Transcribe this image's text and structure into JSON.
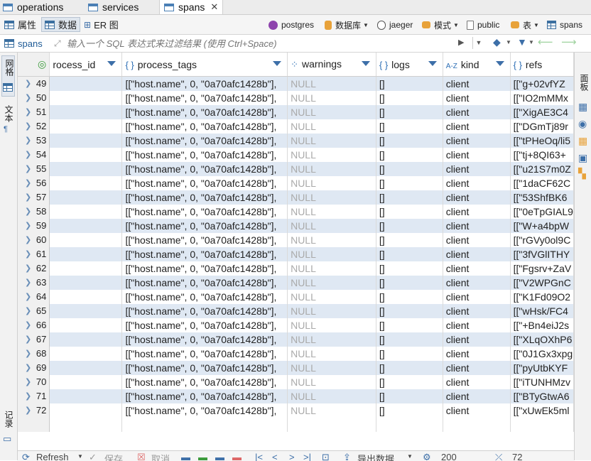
{
  "editor_tabs": [
    {
      "label": "operations"
    },
    {
      "label": "services"
    },
    {
      "label": "spans"
    }
  ],
  "view_tabs": {
    "properties": "属性",
    "data": "数据",
    "er": "ER 图"
  },
  "breadcrumb": {
    "connection": "postgres",
    "database_label": "数据库",
    "database": "jaeger",
    "schema_label": "模式",
    "schema": "public",
    "table_label": "表",
    "table": "spans"
  },
  "filter": {
    "table": "spans",
    "placeholder": "输入一个 SQL 表达式来过滤结果 (使用 Ctrl+Space)"
  },
  "left_rail": {
    "grid": "网格",
    "text": "文本",
    "record": "记录"
  },
  "right_rail": {
    "panels": "面板"
  },
  "columns": [
    {
      "type": "",
      "name": "rocess_id"
    },
    {
      "type": "{ }",
      "name": "process_tags"
    },
    {
      "type": "⁘",
      "name": "warnings"
    },
    {
      "type": "{ }",
      "name": "logs"
    },
    {
      "type": "A-Z",
      "name": "kind"
    },
    {
      "type": "{ }",
      "name": "refs"
    }
  ],
  "rows": [
    {
      "n": "49",
      "tags": "[[\"host.name\", 0, \"0a70afc1428b\"],",
      "warnings": "NULL",
      "logs": "[]",
      "kind": "client",
      "refs": "[[\"g+02vfYZ"
    },
    {
      "n": "50",
      "tags": "[[\"host.name\", 0, \"0a70afc1428b\"],",
      "warnings": "NULL",
      "logs": "[]",
      "kind": "client",
      "refs": "[[\"IO2mMMx"
    },
    {
      "n": "51",
      "tags": "[[\"host.name\", 0, \"0a70afc1428b\"],",
      "warnings": "NULL",
      "logs": "[]",
      "kind": "client",
      "refs": "[[\"XigAE3C4"
    },
    {
      "n": "52",
      "tags": "[[\"host.name\", 0, \"0a70afc1428b\"],",
      "warnings": "NULL",
      "logs": "[]",
      "kind": "client",
      "refs": "[[\"DGmTj89r"
    },
    {
      "n": "53",
      "tags": "[[\"host.name\", 0, \"0a70afc1428b\"],",
      "warnings": "NULL",
      "logs": "[]",
      "kind": "client",
      "refs": "[[\"tPHeOq/li5"
    },
    {
      "n": "54",
      "tags": "[[\"host.name\", 0, \"0a70afc1428b\"],",
      "warnings": "NULL",
      "logs": "[]",
      "kind": "client",
      "refs": "[[\"tj+8QI63+"
    },
    {
      "n": "55",
      "tags": "[[\"host.name\", 0, \"0a70afc1428b\"],",
      "warnings": "NULL",
      "logs": "[]",
      "kind": "client",
      "refs": "[[\"u21S7m0Z"
    },
    {
      "n": "56",
      "tags": "[[\"host.name\", 0, \"0a70afc1428b\"],",
      "warnings": "NULL",
      "logs": "[]",
      "kind": "client",
      "refs": "[[\"1daCF62C"
    },
    {
      "n": "57",
      "tags": "[[\"host.name\", 0, \"0a70afc1428b\"],",
      "warnings": "NULL",
      "logs": "[]",
      "kind": "client",
      "refs": "[[\"53ShfBK6"
    },
    {
      "n": "58",
      "tags": "[[\"host.name\", 0, \"0a70afc1428b\"],",
      "warnings": "NULL",
      "logs": "[]",
      "kind": "client",
      "refs": "[[\"0eTpGIAL9"
    },
    {
      "n": "59",
      "tags": "[[\"host.name\", 0, \"0a70afc1428b\"],",
      "warnings": "NULL",
      "logs": "[]",
      "kind": "client",
      "refs": "[[\"W+a4bpW"
    },
    {
      "n": "60",
      "tags": "[[\"host.name\", 0, \"0a70afc1428b\"],",
      "warnings": "NULL",
      "logs": "[]",
      "kind": "client",
      "refs": "[[\"rGVy0ol9C"
    },
    {
      "n": "61",
      "tags": "[[\"host.name\", 0, \"0a70afc1428b\"],",
      "warnings": "NULL",
      "logs": "[]",
      "kind": "client",
      "refs": "[[\"3fVGlITHY"
    },
    {
      "n": "62",
      "tags": "[[\"host.name\", 0, \"0a70afc1428b\"],",
      "warnings": "NULL",
      "logs": "[]",
      "kind": "client",
      "refs": "[[\"Fgsrv+ZaV"
    },
    {
      "n": "63",
      "tags": "[[\"host.name\", 0, \"0a70afc1428b\"],",
      "warnings": "NULL",
      "logs": "[]",
      "kind": "client",
      "refs": "[[\"V2WPGnC"
    },
    {
      "n": "64",
      "tags": "[[\"host.name\", 0, \"0a70afc1428b\"],",
      "warnings": "NULL",
      "logs": "[]",
      "kind": "client",
      "refs": "[[\"K1Fd09O2"
    },
    {
      "n": "65",
      "tags": "[[\"host.name\", 0, \"0a70afc1428b\"],",
      "warnings": "NULL",
      "logs": "[]",
      "kind": "client",
      "refs": "[[\"wHsk/FC4"
    },
    {
      "n": "66",
      "tags": "[[\"host.name\", 0, \"0a70afc1428b\"],",
      "warnings": "NULL",
      "logs": "[]",
      "kind": "client",
      "refs": "[[\"+Bn4eiJ2s"
    },
    {
      "n": "67",
      "tags": "[[\"host.name\", 0, \"0a70afc1428b\"],",
      "warnings": "NULL",
      "logs": "[]",
      "kind": "client",
      "refs": "[[\"XLqOXhP6"
    },
    {
      "n": "68",
      "tags": "[[\"host.name\", 0, \"0a70afc1428b\"],",
      "warnings": "NULL",
      "logs": "[]",
      "kind": "client",
      "refs": "[[\"0J1Gx3xpg"
    },
    {
      "n": "69",
      "tags": "[[\"host.name\", 0, \"0a70afc1428b\"],",
      "warnings": "NULL",
      "logs": "[]",
      "kind": "client",
      "refs": "[[\"pyUtbKYF"
    },
    {
      "n": "70",
      "tags": "[[\"host.name\", 0, \"0a70afc1428b\"],",
      "warnings": "NULL",
      "logs": "[]",
      "kind": "client",
      "refs": "[[\"iTUNHMzv"
    },
    {
      "n": "71",
      "tags": "[[\"host.name\", 0, \"0a70afc1428b\"],",
      "warnings": "NULL",
      "logs": "[]",
      "kind": "client",
      "refs": "[[\"BTyGtwA6"
    },
    {
      "n": "72",
      "tags": "[[\"host.name\", 0, \"0a70afc1428b\"],",
      "warnings": "NULL",
      "logs": "[]",
      "kind": "client",
      "refs": "[[\"xUwEk5ml"
    }
  ],
  "bottom": {
    "refresh": "Refresh",
    "save": "保存",
    "cancel": "取消",
    "export": "导出数据",
    "fetch_size": "200",
    "row_count": "72"
  },
  "colors": {
    "accent": "#3d6fa8",
    "row_alt": "#dfe8f3",
    "null_text": "#aaaaaa"
  }
}
